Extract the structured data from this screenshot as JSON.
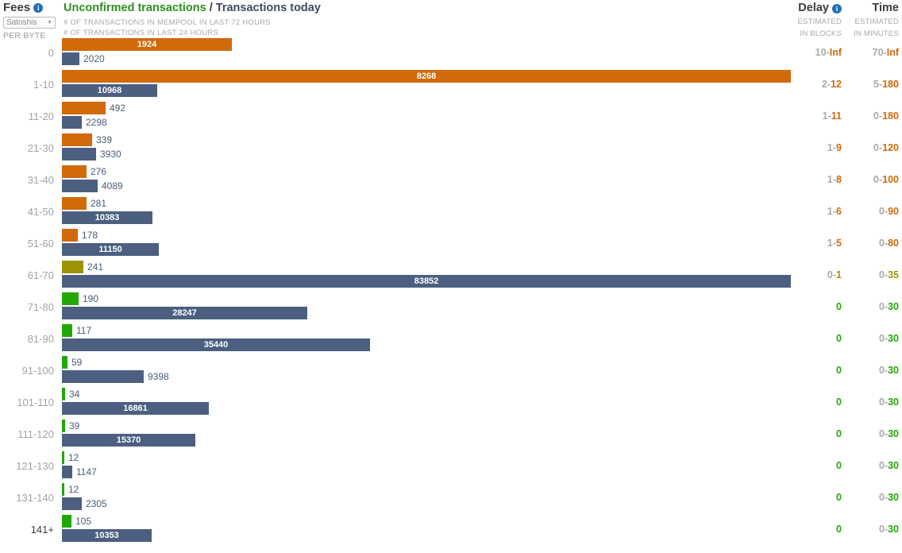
{
  "header": {
    "fees": {
      "title": "Fees",
      "info_icon": "info-icon",
      "unit_value": "Satoshis",
      "unit_caret": "▼",
      "per_byte": "PER BYTE"
    },
    "center": {
      "title_unconfirmed": "Unconfirmed transactions",
      "title_separator": " / ",
      "title_today": "Transactions today",
      "legend_mempool": "# OF TRANSACTIONS IN MEMPOOL IN LAST 72 HOURS",
      "legend_today": "# OF TRANSACTIONS IN LAST 24 HOURS"
    },
    "delay": {
      "title": "Delay",
      "info_icon": "info-icon",
      "sub_line1": "ESTIMATED",
      "sub_line2": "IN BLOCKS"
    },
    "time": {
      "title": "Time",
      "sub_line1": "ESTIMATED",
      "sub_line2": "IN MINUTES"
    }
  },
  "colors": {
    "orange": "#d2690a",
    "olive": "#9c9406",
    "green": "#22a806",
    "slate": "#4c5f80",
    "label_gray": "#a3a3a3",
    "value_blue": "#4a5c7a",
    "green_text": "#22a806",
    "olive_text": "#9c9406",
    "orange_text": "#d2690a"
  },
  "chart_data": {
    "type": "bar",
    "title": "Unconfirmed transactions / Transactions today",
    "xlabel": "",
    "ylabel": "Fees (satoshis per byte)",
    "orientation": "horizontal",
    "grid": false,
    "legend_position": "top",
    "categories": [
      "0",
      "1-10",
      "11-20",
      "21-30",
      "31-40",
      "41-50",
      "51-60",
      "61-70",
      "71-80",
      "81-90",
      "91-100",
      "101-110",
      "111-120",
      "121-130",
      "131-140",
      "141+"
    ],
    "series": [
      {
        "name": "# OF TRANSACTIONS IN MEMPOOL IN LAST 72 HOURS",
        "max": 8268,
        "values": [
          1924,
          8268,
          492,
          339,
          276,
          281,
          178,
          241,
          190,
          117,
          59,
          34,
          39,
          12,
          12,
          105
        ]
      },
      {
        "name": "# OF TRANSACTIONS IN LAST 24 HOURS",
        "max": 83852,
        "values": [
          2020,
          10968,
          2298,
          3930,
          4089,
          10383,
          11150,
          83852,
          28247,
          35440,
          9398,
          16861,
          15370,
          1147,
          2305,
          10353
        ]
      }
    ]
  },
  "rows": [
    {
      "fee": "0",
      "mempool": 1924,
      "today": 2020,
      "color": "orange",
      "delay_lo": "10",
      "delay_hi": "Inf",
      "time_lo": "70",
      "time_hi": "Inf",
      "tone": "orange"
    },
    {
      "fee": "1-10",
      "mempool": 8268,
      "today": 10968,
      "color": "orange",
      "delay_lo": "2",
      "delay_hi": "12",
      "time_lo": "5",
      "time_hi": "180",
      "tone": "orange"
    },
    {
      "fee": "11-20",
      "mempool": 492,
      "today": 2298,
      "color": "orange",
      "delay_lo": "1",
      "delay_hi": "11",
      "time_lo": "0",
      "time_hi": "180",
      "tone": "orange"
    },
    {
      "fee": "21-30",
      "mempool": 339,
      "today": 3930,
      "color": "orange",
      "delay_lo": "1",
      "delay_hi": "9",
      "time_lo": "0",
      "time_hi": "120",
      "tone": "orange"
    },
    {
      "fee": "31-40",
      "mempool": 276,
      "today": 4089,
      "color": "orange",
      "delay_lo": "1",
      "delay_hi": "8",
      "time_lo": "0",
      "time_hi": "100",
      "tone": "orange"
    },
    {
      "fee": "41-50",
      "mempool": 281,
      "today": 10383,
      "color": "orange",
      "delay_lo": "1",
      "delay_hi": "6",
      "time_lo": "0",
      "time_hi": "90",
      "tone": "orange"
    },
    {
      "fee": "51-60",
      "mempool": 178,
      "today": 11150,
      "color": "orange",
      "delay_lo": "1",
      "delay_hi": "5",
      "time_lo": "0",
      "time_hi": "80",
      "tone": "orange"
    },
    {
      "fee": "61-70",
      "mempool": 241,
      "today": 83852,
      "color": "olive",
      "delay_lo": "0",
      "delay_hi": "1",
      "time_lo": "0",
      "time_hi": "35",
      "tone": "olive"
    },
    {
      "fee": "71-80",
      "mempool": 190,
      "today": 28247,
      "color": "green",
      "delay_lo": "",
      "delay_hi": "0",
      "time_lo": "0",
      "time_hi": "30",
      "tone": "green"
    },
    {
      "fee": "81-90",
      "mempool": 117,
      "today": 35440,
      "color": "green",
      "delay_lo": "",
      "delay_hi": "0",
      "time_lo": "0",
      "time_hi": "30",
      "tone": "green"
    },
    {
      "fee": "91-100",
      "mempool": 59,
      "today": 9398,
      "color": "green",
      "delay_lo": "",
      "delay_hi": "0",
      "time_lo": "0",
      "time_hi": "30",
      "tone": "green"
    },
    {
      "fee": "101-110",
      "mempool": 34,
      "today": 16861,
      "color": "green",
      "delay_lo": "",
      "delay_hi": "0",
      "time_lo": "0",
      "time_hi": "30",
      "tone": "green"
    },
    {
      "fee": "111-120",
      "mempool": 39,
      "today": 15370,
      "color": "green",
      "delay_lo": "",
      "delay_hi": "0",
      "time_lo": "0",
      "time_hi": "30",
      "tone": "green"
    },
    {
      "fee": "121-130",
      "mempool": 12,
      "today": 1147,
      "color": "green",
      "delay_lo": "",
      "delay_hi": "0",
      "time_lo": "0",
      "time_hi": "30",
      "tone": "green"
    },
    {
      "fee": "131-140",
      "mempool": 12,
      "today": 2305,
      "color": "green",
      "delay_lo": "",
      "delay_hi": "0",
      "time_lo": "0",
      "time_hi": "30",
      "tone": "green"
    },
    {
      "fee": "141+",
      "mempool": 105,
      "today": 10353,
      "color": "green",
      "delay_lo": "",
      "delay_hi": "0",
      "time_lo": "0",
      "time_hi": "30",
      "tone": "green"
    }
  ]
}
